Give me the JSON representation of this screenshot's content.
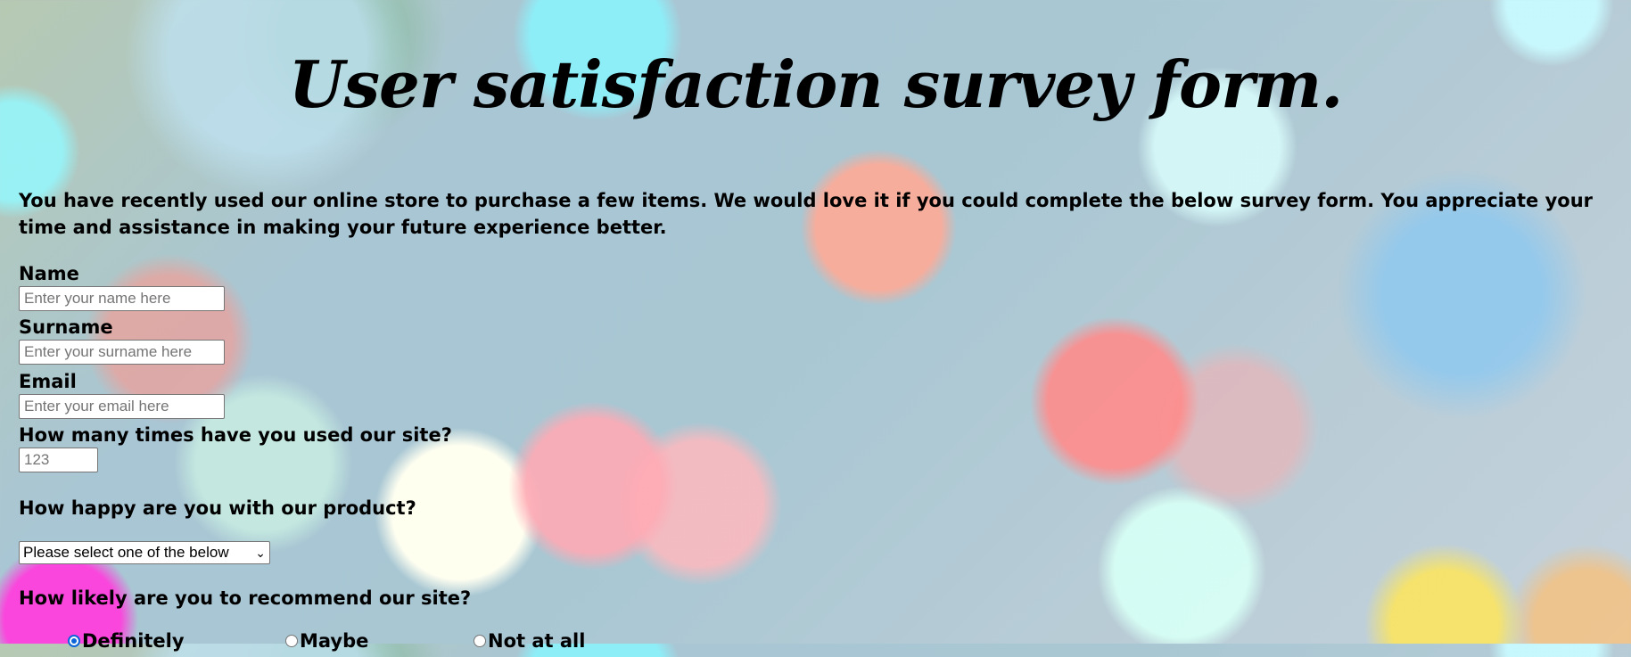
{
  "title": "User satisfaction survey form.",
  "intro": "You have recently used our online store to purchase a few items. We would love it if you could complete the below survey form. You appreciate your time and assistance in making your future experience better.",
  "fields": {
    "name": {
      "label": "Name",
      "placeholder": "Enter your name here"
    },
    "surname": {
      "label": "Surname",
      "placeholder": "Enter your surname here"
    },
    "email": {
      "label": "Email",
      "placeholder": "Enter your email here"
    },
    "uses": {
      "label": "How many times have you used our site?",
      "placeholder": "123"
    }
  },
  "happy": {
    "label": "How happy are you with our product?",
    "selected": "Please select one of the below"
  },
  "recommend": {
    "label": "How likely are you to recommend our site?",
    "options": [
      "Definitely",
      "Maybe",
      "Not at all"
    ],
    "selected": "Definitely"
  }
}
